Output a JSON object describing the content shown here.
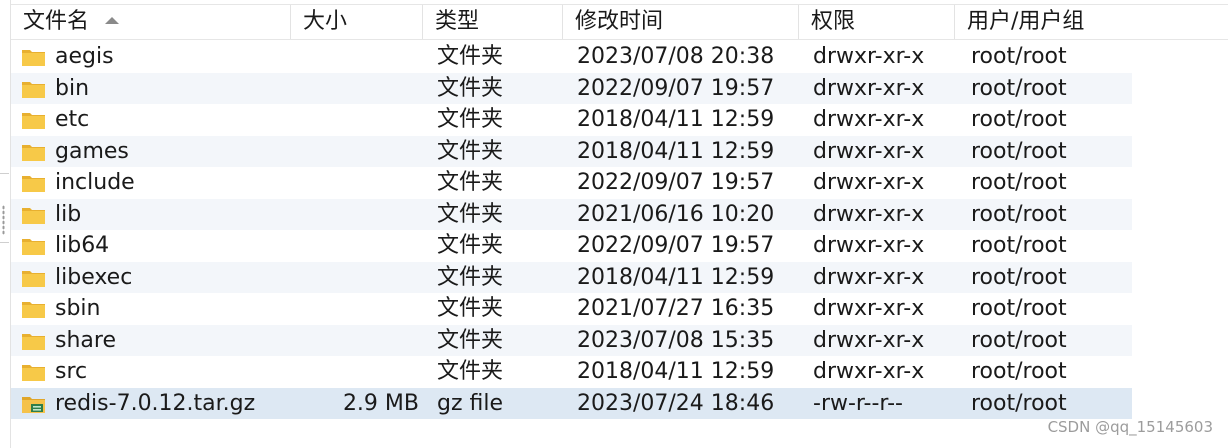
{
  "columns": {
    "name": "文件名",
    "size": "大小",
    "type": "类型",
    "modified": "修改时间",
    "permissions": "权限",
    "owner": "用户/用户组"
  },
  "rows": [
    {
      "name": "aegis",
      "size": "",
      "type": "文件夹",
      "modified": "2023/07/08 20:38",
      "permissions": "drwxr-xr-x",
      "owner": "root/root",
      "icon": "folder-icon"
    },
    {
      "name": "bin",
      "size": "",
      "type": "文件夹",
      "modified": "2022/09/07 19:57",
      "permissions": "drwxr-xr-x",
      "owner": "root/root",
      "icon": "folder-icon"
    },
    {
      "name": "etc",
      "size": "",
      "type": "文件夹",
      "modified": "2018/04/11 12:59",
      "permissions": "drwxr-xr-x",
      "owner": "root/root",
      "icon": "folder-icon"
    },
    {
      "name": "games",
      "size": "",
      "type": "文件夹",
      "modified": "2018/04/11 12:59",
      "permissions": "drwxr-xr-x",
      "owner": "root/root",
      "icon": "folder-icon"
    },
    {
      "name": "include",
      "size": "",
      "type": "文件夹",
      "modified": "2022/09/07 19:57",
      "permissions": "drwxr-xr-x",
      "owner": "root/root",
      "icon": "folder-icon"
    },
    {
      "name": "lib",
      "size": "",
      "type": "文件夹",
      "modified": "2021/06/16 10:20",
      "permissions": "drwxr-xr-x",
      "owner": "root/root",
      "icon": "folder-icon"
    },
    {
      "name": "lib64",
      "size": "",
      "type": "文件夹",
      "modified": "2022/09/07 19:57",
      "permissions": "drwxr-xr-x",
      "owner": "root/root",
      "icon": "folder-icon"
    },
    {
      "name": "libexec",
      "size": "",
      "type": "文件夹",
      "modified": "2018/04/11 12:59",
      "permissions": "drwxr-xr-x",
      "owner": "root/root",
      "icon": "folder-icon"
    },
    {
      "name": "sbin",
      "size": "",
      "type": "文件夹",
      "modified": "2021/07/27 16:35",
      "permissions": "drwxr-xr-x",
      "owner": "root/root",
      "icon": "folder-icon"
    },
    {
      "name": "share",
      "size": "",
      "type": "文件夹",
      "modified": "2023/07/08 15:35",
      "permissions": "drwxr-xr-x",
      "owner": "root/root",
      "icon": "folder-icon"
    },
    {
      "name": "src",
      "size": "",
      "type": "文件夹",
      "modified": "2018/04/11 12:59",
      "permissions": "drwxr-xr-x",
      "owner": "root/root",
      "icon": "folder-icon"
    },
    {
      "name": "redis-7.0.12.tar.gz",
      "size": "2.9 MB",
      "type": "gz file",
      "modified": "2023/07/24 18:46",
      "permissions": "-rw-r--r--",
      "owner": "root/root",
      "icon": "archive-file-icon",
      "selected": true
    }
  ],
  "watermark": "CSDN @qq_15145603",
  "colors": {
    "row_alt": "#f3f6fa",
    "row_selected": "#dde8f3",
    "folder": "#f7c948"
  }
}
